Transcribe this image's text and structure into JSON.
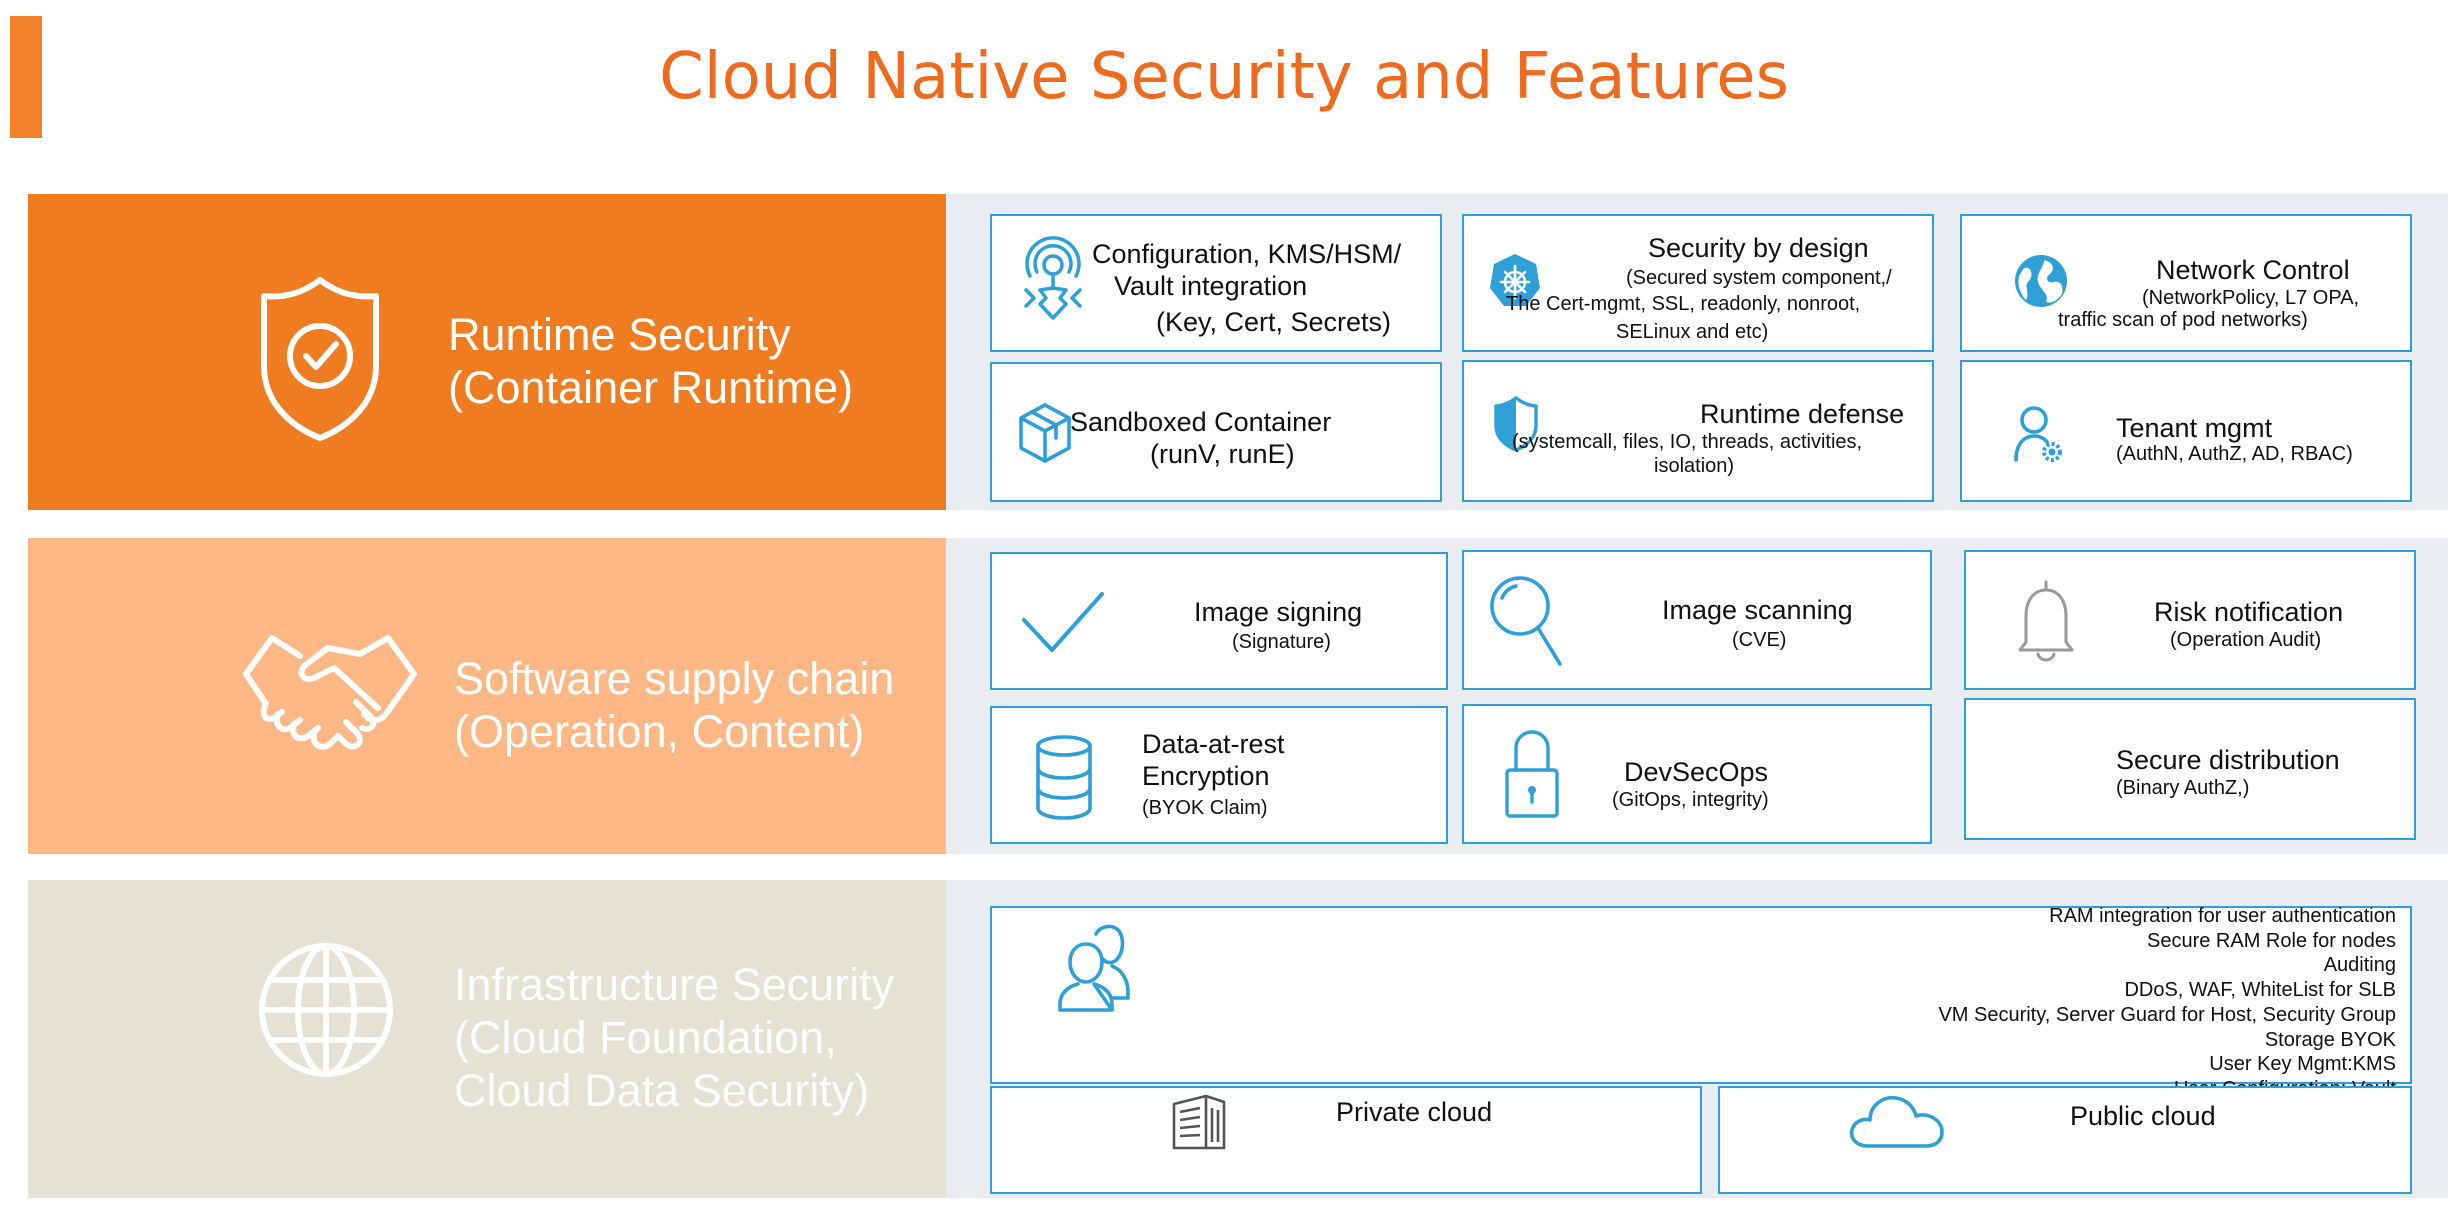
{
  "title": "Cloud Native Security and Features",
  "colors": {
    "accent": "#f2822a",
    "runtime_band": "#f07c22",
    "supply_band": "#fdb886",
    "infra_band": "#e4e2d2",
    "panel": "#e9edf1",
    "border": "#2e9fd7"
  },
  "runtime": {
    "label_line1": "Runtime Security",
    "label_line2": "(Container Runtime)",
    "icon": "shield-check-icon",
    "cards": {
      "config": {
        "line1": "Configuration, KMS/HSM/",
        "line2": "Vault integration",
        "line3": "(Key, Cert, Secrets)",
        "icon": "key-icon"
      },
      "design": {
        "title": "Security by design",
        "detail1": "(Secured system component,/",
        "detail2": "The Cert-mgmt, SSL, readonly, nonroot,",
        "detail3": "SELinux and etc)",
        "icon": "kubernetes-helm-icon"
      },
      "network": {
        "title": "Network Control",
        "detail1": "(NetworkPolicy, L7 OPA,",
        "detail2": "traffic scan of pod networks)",
        "icon": "globe-network-icon"
      },
      "sandbox": {
        "title": "Sandboxed Container",
        "detail": "(runV, runE)",
        "icon": "cube-icon"
      },
      "defense": {
        "title": "Runtime defense",
        "detail1": "(systemcall, files, IO, threads, activities,",
        "detail2": "isolation)",
        "icon": "shield-half-icon"
      },
      "tenant": {
        "title": "Tenant mgmt",
        "detail": "(AuthN, AuthZ, AD, RBAC)",
        "icon": "user-gear-icon"
      }
    }
  },
  "supply": {
    "label_line1": "Software supply chain",
    "label_line2": "(Operation, Content)",
    "icon": "handshake-icon",
    "cards": {
      "signing": {
        "title": "Image signing",
        "detail": "(Signature)",
        "icon": "checkmark-icon"
      },
      "scanning": {
        "title": "Image scanning",
        "detail": "(CVE)",
        "icon": "magnifier-icon"
      },
      "risk": {
        "title": "Risk notification",
        "detail": "(Operation Audit)",
        "icon": "bell-icon"
      },
      "encryption": {
        "title1": "Data-at-rest",
        "title2": "Encryption",
        "detail": "(BYOK Claim)",
        "icon": "database-icon"
      },
      "devsecops": {
        "title": "DevSecOps",
        "detail": "(GitOps, integrity)",
        "icon": "padlock-icon"
      },
      "distribution": {
        "title": "Secure distribution",
        "detail": "(Binary AuthZ,)"
      }
    }
  },
  "infra": {
    "label_line1": "Infrastructure Security",
    "label_line2": "(Cloud Foundation,",
    "label_line3": "Cloud Data Security)",
    "icon": "globe-icon",
    "users_icon": "users-icon",
    "items": [
      "RAM  integration for user authentication",
      "Secure RAM Role for nodes",
      "Auditing",
      "DDoS, WAF, WhiteList for SLB",
      "VM Security, Server Guard for Host, Security Group",
      "Storage BYOK",
      "User Key Mgmt:KMS",
      "User Configuration: Vault"
    ],
    "private_cloud": {
      "label": "Private cloud",
      "icon": "server-building-icon"
    },
    "public_cloud": {
      "label": "Public cloud",
      "icon": "cloud-icon"
    }
  }
}
